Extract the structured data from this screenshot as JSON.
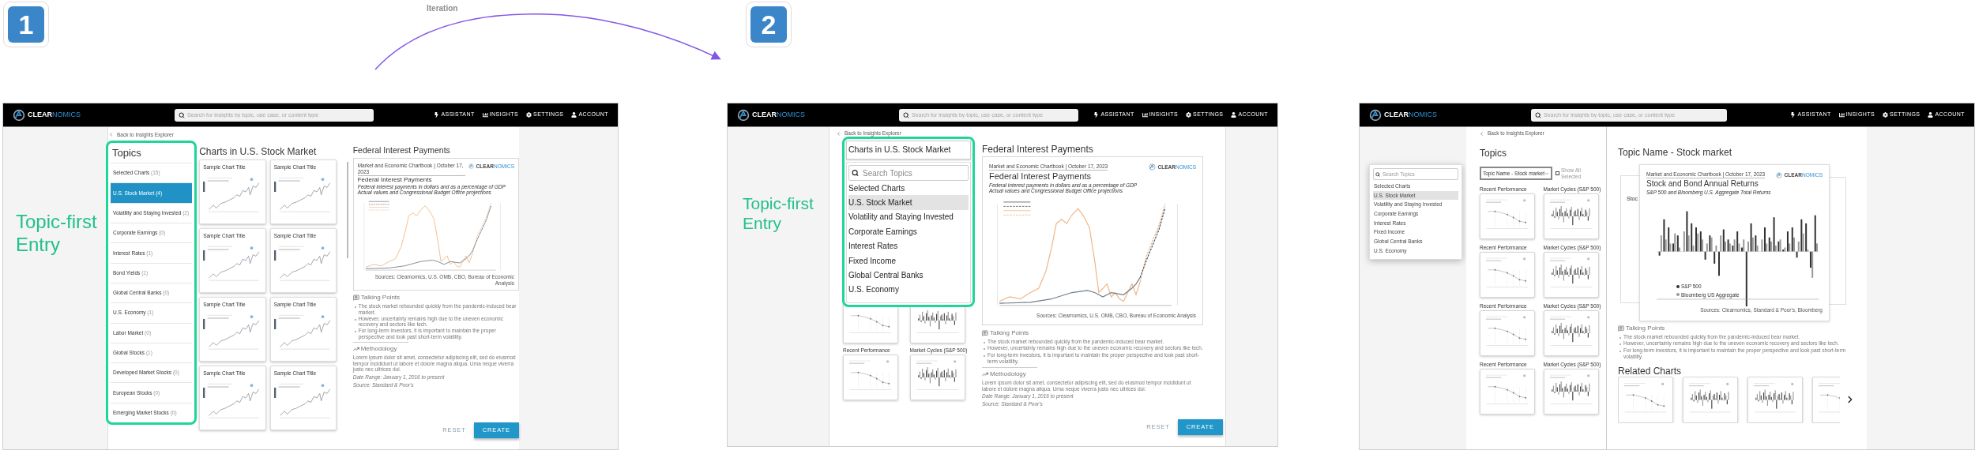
{
  "steps": [
    {
      "number": "1"
    },
    {
      "number": "2"
    }
  ],
  "transition": {
    "label": "Iteration"
  },
  "screens": [
    {
      "kind": "topic_list",
      "header": {
        "logo": {
          "part_1": "CLEAR",
          "part_2": "NOMICS"
        },
        "search_placeholder": "Search for insights by topic, use case, or content type",
        "nav": [
          {
            "kind": "assistant",
            "label": "ASSISTANT"
          },
          {
            "kind": "insights",
            "label": "INSIGHTS"
          },
          {
            "kind": "settings",
            "label": "SETTINGS"
          },
          {
            "kind": "account",
            "label": "ACCOUNT"
          }
        ]
      },
      "caption": "Topic-first Entry",
      "back_link": "Back to Insights Explorer",
      "topics": {
        "title": "Topics",
        "items": [
          {
            "label": "Selected Charts",
            "count": "(15)",
            "selected": false
          },
          {
            "label": "U.S. Stock Market",
            "count": "(4)",
            "selected": true
          },
          {
            "label": "Volatility and Staying Invested",
            "count": "(2)",
            "selected": false
          },
          {
            "label": "Corporate Earnings",
            "count": "(0)",
            "selected": false
          },
          {
            "label": "Interest Rates",
            "count": "(1)",
            "selected": false
          },
          {
            "label": "Bond Yields",
            "count": "(1)",
            "selected": false
          },
          {
            "label": "Global Central Banks",
            "count": "(0)",
            "selected": false
          },
          {
            "label": "U.S. Economy",
            "count": "(1)",
            "selected": false
          },
          {
            "label": "Labor Market",
            "count": "(0)",
            "selected": false
          },
          {
            "label": "Global Stocks",
            "count": "(1)",
            "selected": false
          },
          {
            "label": "Developed Market Stocks",
            "count": "(0)",
            "selected": false
          },
          {
            "label": "European Stocks",
            "count": "(0)",
            "selected": false
          },
          {
            "label": "Emerging Market Stocks",
            "count": "(0)",
            "selected": false
          }
        ]
      },
      "charts": {
        "title": "Charts in U.S. Stock Market",
        "cards": [
          {
            "title": "Sample Chart Title",
            "kind": "line"
          },
          {
            "title": "Sample Chart Title",
            "kind": "line"
          },
          {
            "title": "Sample Chart Title",
            "kind": "line"
          },
          {
            "title": "Sample Chart Title",
            "kind": "line"
          },
          {
            "title": "Sample Chart Title",
            "kind": "line"
          },
          {
            "title": "Sample Chart Title",
            "kind": "line"
          },
          {
            "title": "Sample Chart Title",
            "kind": "line"
          },
          {
            "title": "Sample Chart Title",
            "kind": "line"
          }
        ]
      },
      "detail": {
        "title": "Federal Interest Payments",
        "chart": {
          "header": "Market and Economic Chartbook | October 17, 2023",
          "title": "Federal Interest Payments",
          "subtitle_lines": [
            "Federal interest payments in dollars and as a percentage of GDP",
            "Actual values and Congressional Budget Office projections"
          ],
          "logo": {
            "part_1": "CLEAR",
            "part_2": "NOMICS"
          },
          "sources": "Sources: Clearnomics, U.S. OMB, CBO, Bureau of Economic Analysis"
        },
        "talking_points": {
          "title": "Talking Points",
          "items": [
            "The stock market rebounded quickly from the pandemic-induced bear market.",
            "However, uncertainty remains high due to the uneven economic recovery and sectors like tech.",
            "For long-term investors, it is important to maintain the proper perspective and look past short-term volatility."
          ]
        },
        "methodology": {
          "title": "Methodology",
          "text": "Lorem ipsum dolor sit amet, consectetur adipiscing elit, sed do eiusmod tempor incididunt ut labore et dolore magna aliqua. Urna neque viverra justo nec ultrices dui.",
          "date_range": "Date Range: January 1, 2016 to present",
          "source": "Source: Standard & Poor's"
        }
      },
      "buttons": [
        {
          "kind": "secondary",
          "label": "RESET"
        },
        {
          "kind": "primary",
          "label": "CREATE"
        }
      ]
    },
    {
      "kind": "topic_dropdown",
      "header": {
        "logo": {
          "part_1": "CLEAR",
          "part_2": "NOMICS"
        },
        "search_placeholder": "Search for insights by topic, use case, or content type",
        "nav": [
          {
            "kind": "assistant",
            "label": "ASSISTANT"
          },
          {
            "kind": "insights",
            "label": "INSIGHTS"
          },
          {
            "kind": "settings",
            "label": "SETTINGS"
          },
          {
            "kind": "account",
            "label": "ACCOUNT"
          }
        ]
      },
      "caption": "Topic-first Entry",
      "back_link": "Back to Insights Explorer",
      "dropdown": {
        "title": "Charts in U.S. Stock Market",
        "search_placeholder": "Search Topics",
        "items": [
          {
            "label": "Selected Charts",
            "selected": false
          },
          {
            "label": "U.S. Stock Market",
            "selected": true
          },
          {
            "label": "Volatility and Staying Invested",
            "selected": false
          },
          {
            "label": "Corporate Earnings",
            "selected": false
          },
          {
            "label": "Interest Rates",
            "selected": false
          },
          {
            "label": "Fixed Income",
            "selected": false
          },
          {
            "label": "Global Central Banks",
            "selected": false
          },
          {
            "label": "U.S. Economy",
            "selected": false
          }
        ]
      },
      "thumbnails": [
        {
          "kind": "dots"
        },
        {
          "kind": "bars"
        },
        {
          "label": "Recent Performance",
          "kind": "dots"
        },
        {
          "label": "Market Cycles (S&P 500)",
          "kind": "bars"
        }
      ],
      "detail": {
        "title": "Federal Interest Payments",
        "chart": {
          "header": "Market and Economic Chartbook | October 17, 2023",
          "title": "Federal Interest Payments",
          "subtitle_lines": [
            "Federal interest payments in dollars and as a percentage of GDP",
            "Actual values and Congressional Budget Office projections"
          ],
          "logo": {
            "part_1": "CLEAR",
            "part_2": "NOMICS"
          },
          "sources": "Sources: Clearnomics, U.S. OMB, CBO, Bureau of Economic Analysis"
        },
        "talking_points": {
          "title": "Talking Points",
          "items": [
            "The stock market rebounded quickly from the pandemic-induced bear market.",
            "However, uncertainty remains high due to the uneven economic recovery and sectors like tech.",
            "For long-term investors, it is important to maintain the proper perspective and look past short-term volatility."
          ]
        },
        "methodology": {
          "title": "Methodology",
          "text": "Lorem ipsum dolor sit amet, consectetur adipiscing elit, sed do eiusmod tempor incididunt ut labore et dolore magna aliqua. Urna neque viverra justo nec ultrices dui.",
          "date_range": "Date Range: January 1, 2016 to present",
          "source": "Source: Standard & Poor's"
        }
      },
      "buttons": [
        {
          "kind": "secondary",
          "label": "RESET"
        },
        {
          "kind": "primary",
          "label": "CREATE"
        }
      ]
    },
    {
      "kind": "split",
      "header": {
        "logo": {
          "part_1": "CLEAR",
          "part_2": "NOMICS"
        },
        "search_placeholder": "Search for insights by topic, use case, or content type",
        "nav": [
          {
            "kind": "assistant",
            "label": "ASSISTANT"
          },
          {
            "kind": "insights",
            "label": "INSIGHTS"
          },
          {
            "kind": "settings",
            "label": "SETTINGS"
          },
          {
            "kind": "account",
            "label": "ACCOUNT"
          }
        ]
      },
      "menu": {
        "search_placeholder": "Search Topics",
        "items": [
          {
            "label": "Selected Charts",
            "selected": false
          },
          {
            "label": "U.S. Stock Market",
            "selected": true
          },
          {
            "label": "Volatility and Staying Invested",
            "selected": false
          },
          {
            "label": "Corporate Earnings",
            "selected": false
          },
          {
            "label": "Interest Rates",
            "selected": false
          },
          {
            "label": "Fixed Income",
            "selected": false
          },
          {
            "label": "Global Central Banks",
            "selected": false
          },
          {
            "label": "U.S. Economy",
            "selected": false
          }
        ]
      },
      "back_link": "Back to Insights Explorer",
      "topics": {
        "title": "Topics",
        "select_value": "Topic Name - Stock market",
        "show_all": {
          "label": "Show All Selected",
          "checked": false
        },
        "cards": [
          {
            "label": "Recent Performance",
            "kind": "dots"
          },
          {
            "label": "Market Cycles (S&P 500)",
            "kind": "bars"
          },
          {
            "label": "Recent Performance",
            "kind": "dots"
          },
          {
            "label": "Market Cycles (S&P 500)",
            "kind": "bars"
          },
          {
            "label": "Recent Performance",
            "kind": "dots"
          },
          {
            "label": "Market Cycles (S&P 500)",
            "kind": "bars"
          },
          {
            "label": "Recent Performance",
            "kind": "dots"
          },
          {
            "label": "Market Cycles (S&P 500)",
            "kind": "bars"
          }
        ]
      },
      "detail": {
        "title": "Topic Name - Stock market",
        "stack": {
          "back_title": "Stoc",
          "front": {
            "header": "Market and Economic Chartbook | October 17, 2023",
            "title": "Stock and Bond Annual Returns",
            "subtitle": "S&P 500 and Bloomberg U.S. Aggregate Total Returns",
            "logo": {
              "part_1": "CLEAR",
              "part_2": "NOMICS"
            },
            "legend": [
              {
                "label": "S&P 500",
                "color": "#333333"
              },
              {
                "label": "Bloomberg US Aggregate",
                "color": "#999999"
              }
            ],
            "sources": "Sources: Clearnomics, Standard & Poor's, Bloomberg"
          }
        },
        "talking_points": {
          "title": "Talking Points",
          "items": [
            "The stock market rebounded quickly from the pandemic-induced bear market.",
            "However, uncertainty remains high due to the uneven economic recovery and sectors like tech.",
            "For long-term investors, it is important to maintain the proper perspective and look past short-term volatility."
          ]
        },
        "related": {
          "title": "Related Charts",
          "cards": [
            {
              "kind": "dots"
            },
            {
              "kind": "bars"
            },
            {
              "kind": "bars"
            },
            {
              "kind": "dots"
            }
          ]
        }
      }
    }
  ]
}
